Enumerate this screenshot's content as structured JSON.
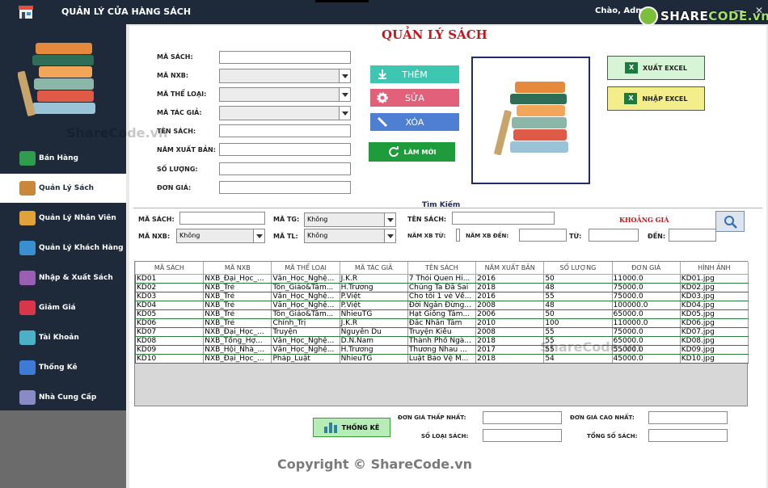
{
  "window": {
    "title": "QUẢN LÝ CỬA HÀNG SÁCH",
    "greeting": "Chào,  Admin"
  },
  "watermark": {
    "logo_prefix": "SHARE",
    "logo_suffix": "CODE.vn",
    "text": "ShareCode.vn",
    "copyright": "Copyright © ShareCode.vn"
  },
  "sidebar": {
    "items": [
      {
        "label": "Bán Hàng",
        "color": "#2e9e4e"
      },
      {
        "label": "Quản Lý Sách",
        "color": "#c8873a"
      },
      {
        "label": "Quản Lý Nhân Viên",
        "color": "#e2a23a"
      },
      {
        "label": "Quản Lý Khách Hàng",
        "color": "#3a8fd1"
      },
      {
        "label": "Nhập & Xuất Sách",
        "color": "#9a5fb5"
      },
      {
        "label": "Giảm Giá",
        "color": "#d9364a"
      },
      {
        "label": "Tài Khoản",
        "color": "#4bb1c7"
      },
      {
        "label": "Thống Kê",
        "color": "#3d7bd6"
      },
      {
        "label": "Nhà Cung Cấp",
        "color": "#8a8ac6"
      }
    ]
  },
  "form": {
    "heading": "QUẢN LÝ SÁCH",
    "fields": {
      "ma_sach": "MÃ SÁCH:",
      "ma_nxb": "MÃ NXB:",
      "ma_the_loai": "MÃ THỂ LOẠI:",
      "ma_tac_gia": "MÃ TÁC GIẢ:",
      "ten_sach": "TÊN SÁCH:",
      "nam_xuat_ban": "NĂM XUẤT BẢN:",
      "so_luong": "SỐ LƯỢNG:",
      "don_gia": "ĐƠN GIÁ:"
    },
    "buttons": {
      "them": "THÊM",
      "sua": "SỬA",
      "xoa": "XÓA",
      "lam_moi": "LÀM MỚI",
      "xuat_excel": "XUẤT EXCEL",
      "nhap_excel": "NHẬP EXCEL"
    }
  },
  "search": {
    "title": "Tìm Kiếm",
    "ma_sach": "MÃ SÁCH:",
    "ma_nxb": "MÃ NXB:",
    "ma_tg": "MÃ TG:",
    "ma_tl": "MÃ TL:",
    "ten_sach": "TÊN SÁCH:",
    "khoang_gia": "KHOẢNG GIÁ",
    "nam_xb_tu": "NĂM XB TỪ:",
    "nam_xb_den": "NĂM XB ĐẾN:",
    "tu": "TỪ:",
    "den": "ĐẾN:",
    "combo_value": "Không"
  },
  "table": {
    "columns": [
      "MÃ SÁCH",
      "MÃ NXB",
      "MÃ THỂ LOẠI",
      "MÃ TÁC GIẢ",
      "TÊN SÁCH",
      "NĂM XUẤT BẢN",
      "SỐ LƯỢNG",
      "ĐƠN GIÁ",
      "HÌNH ẢNH"
    ],
    "rows": [
      [
        "KD01",
        "NXB_Đại_Học_...",
        "Văn_Học_Nghệ...",
        "J.K.R",
        "7 Thói Quen Hi...",
        "2016",
        "50",
        "11000.0",
        "KD01.jpg"
      ],
      [
        "KD02",
        "NXB_Trẻ",
        "Tôn_Giáo&Tâm...",
        "H.Trương",
        "Chúng Ta Đã Sai",
        "2018",
        "48",
        "75000.0",
        "KD02.jpg"
      ],
      [
        "KD03",
        "NXB_Trẻ",
        "Văn_Học_Nghệ...",
        "P.Việt",
        "Cho tôi 1 vé Về...",
        "2016",
        "55",
        "75000.0",
        "KD03.jpg"
      ],
      [
        "KD04",
        "NXB_Trẻ",
        "Văn_Học_Nghệ...",
        "P.Việt",
        "Đời Ngắn Đừng...",
        "2008",
        "48",
        "100000.0",
        "KD04.jpg"
      ],
      [
        "KD05",
        "NXB_Trẻ",
        "Tôn_Giáo&Tâm...",
        "NhieuTG",
        "Hạt Giống Tâm...",
        "2006",
        "50",
        "65000.0",
        "KD05.jpg"
      ],
      [
        "KD06",
        "NXB_Trẻ",
        "Chính_Trị",
        "J.K.R",
        "Đắc Nhân Tâm",
        "2010",
        "100",
        "110000.0",
        "KD06.jpg"
      ],
      [
        "KD07",
        "NXB_Đại_Học_...",
        "Truyện",
        "Nguyễn Du",
        "Truyện Kiều",
        "2008",
        "55",
        "75000.0",
        "KD07.jpg"
      ],
      [
        "KD08",
        "NXB_Tổng_Hợ...",
        "Văn_Học_Nghệ...",
        "D.N.Nam",
        "Thành Phố Ngà...",
        "2018",
        "55",
        "65000.0",
        "KD08.jpg"
      ],
      [
        "KD09",
        "NXB_Hội_Nhà_...",
        "Văn_Học_Nghệ...",
        "H.Trương",
        "Thương Nhau ...",
        "2017",
        "55",
        "55000.0",
        "KD09.jpg"
      ],
      [
        "KD10",
        "NXB_Đại_Học_...",
        "Pháp_Luật",
        "NhieuTG",
        "Luật Bảo Vệ M...",
        "2018",
        "54",
        "45000.0",
        "KD10.jpg"
      ]
    ]
  },
  "stats": {
    "button": "THỐNG KÊ",
    "min_price": "ĐƠN GIÁ THẤP NHẤT:",
    "max_price": "ĐƠN GIÁ CAO NHẤT:",
    "num_types": "SỐ LOẠI SÁCH:",
    "total": "TỔNG SỐ SÁCH:"
  }
}
